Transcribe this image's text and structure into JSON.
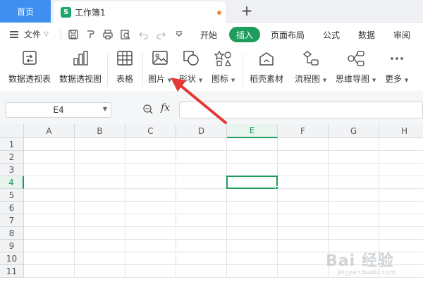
{
  "tabs": {
    "home": "首页",
    "document": "工作簿1",
    "new_tab": "+"
  },
  "menubar": {
    "file": "文件",
    "items": [
      "开始",
      "插入",
      "页面布局",
      "公式",
      "数据",
      "审阅"
    ],
    "active": "插入"
  },
  "ribbon": {
    "pivot_table": "数据透视表",
    "pivot_chart": "数据透视图",
    "table": "表格",
    "picture": "图片",
    "shapes": "形状",
    "icons": "图标",
    "material": "稻壳素材",
    "flowchart": "流程图",
    "mindmap": "思维导图",
    "more": "更多"
  },
  "formula": {
    "name_box": "E4",
    "fx": "fx",
    "value": ""
  },
  "grid": {
    "columns": [
      "A",
      "B",
      "C",
      "D",
      "E",
      "F",
      "G",
      "H"
    ],
    "rows": [
      "1",
      "2",
      "3",
      "4",
      "5",
      "6",
      "7",
      "8",
      "9",
      "10",
      "11"
    ],
    "active_col": "E",
    "active_row": "4"
  },
  "colors": {
    "accent": "#1d9c5c",
    "home_tab": "#3f8ff0",
    "arrow": "#e53935"
  },
  "watermark": {
    "text": "Bai 经验",
    "sub": "jingyan.baidu.com"
  }
}
